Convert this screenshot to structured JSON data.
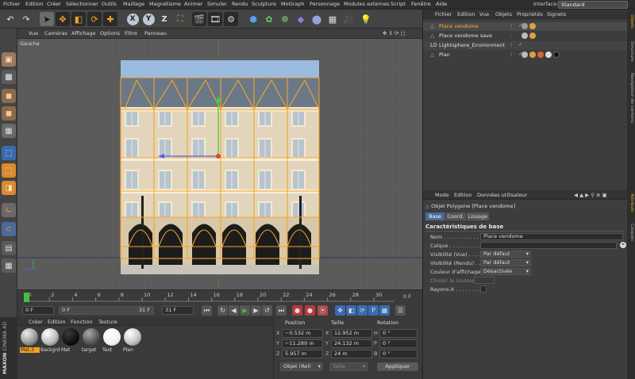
{
  "menubar": {
    "items": [
      "Fichier",
      "Edition",
      "Créer",
      "Sélectionner",
      "Outils",
      "Maillage",
      "Magnétisme",
      "Animer",
      "Simuler",
      "Rendu",
      "Sculpture",
      "MoGraph",
      "Personnage",
      "Modules externes",
      "Script",
      "Fenêtre",
      "Aide"
    ],
    "interface_label": "Interface:",
    "interface_value": "Standard"
  },
  "toolbar": {
    "axis_labels": {
      "x": "X",
      "y": "Y",
      "z": "Z"
    }
  },
  "viewport": {
    "menu": [
      "Vue",
      "Caméras",
      "Affichage",
      "Options",
      "Filtre",
      "Panneau"
    ],
    "view_name": "Gauche"
  },
  "timeline": {
    "ticks": [
      "0",
      "2",
      "4",
      "6",
      "8",
      "10",
      "12",
      "14",
      "16",
      "18",
      "20",
      "22",
      "24",
      "26",
      "28",
      "30"
    ],
    "end_label": "0 F",
    "current_frame": 0
  },
  "time_controls": {
    "start": "0 F",
    "range_start": "0 F",
    "range_end": "31 F",
    "end": "31 F"
  },
  "materials": {
    "menu": [
      "Créer",
      "Edition",
      "Fonction",
      "Texture"
    ],
    "items": [
      {
        "label": "Mat.3",
        "color": "#9a9a9a"
      },
      {
        "label": "Backgrd",
        "color": "#bdbdbd"
      },
      {
        "label": "Mat",
        "color": "#1a1a1a"
      },
      {
        "label": "target",
        "color": "#6a6a6a"
      },
      {
        "label": "Text",
        "color": "#f2f2f2"
      },
      {
        "label": "Plan",
        "color": "#c8c8c8"
      }
    ]
  },
  "brand": {
    "line1": "MAXON",
    "line2": "CINEMA 4D"
  },
  "coords": {
    "headers": {
      "position": "Position",
      "size": "Taille",
      "rotation": "Rotation"
    },
    "rows": [
      {
        "axis": "X",
        "pos": "−0.532 m",
        "size_axis": "X",
        "size": "12.952 m",
        "rot_axis": "H",
        "rot": "0 °"
      },
      {
        "axis": "Y",
        "pos": "−11.289 m",
        "size_axis": "Y",
        "size": "24.132 m",
        "rot_axis": "P",
        "rot": "0 °"
      },
      {
        "axis": "Z",
        "pos": "5.957 m",
        "size_axis": "Z",
        "size": "24 m",
        "rot_axis": "B",
        "rot": "0 °"
      }
    ],
    "mode": "Objet (Rel)",
    "size_mode": "Taille",
    "apply": "Appliquer"
  },
  "object_manager": {
    "menu": [
      "Fichier",
      "Edition",
      "Vue",
      "Objets",
      "Propriétés",
      "Signets"
    ],
    "objects": [
      {
        "name": "Place vendome",
        "color": "#ffb030",
        "selected": true,
        "icon": "polygon-icon"
      },
      {
        "name": "Place vendome save",
        "color": "#e0e0e0",
        "selected": false,
        "icon": "polygon-icon"
      },
      {
        "name": "Lightsphere_Environment",
        "color": "#e0e0e0",
        "selected": false,
        "icon": "null-icon"
      },
      {
        "name": "Plan",
        "color": "#e0e0e0",
        "selected": false,
        "icon": "polygon-icon"
      }
    ]
  },
  "attributes": {
    "menu": [
      "Mode",
      "Edition",
      "Données utilisateur"
    ],
    "object_title": "Objet Polygone [Place vendome]",
    "tabs": [
      "Base",
      "Coord.",
      "Lissage"
    ],
    "section": "Caractéristiques de base",
    "fields": [
      {
        "label": "Nom . . . . . . . . . . . . .",
        "value": "Place vendome",
        "type": "text"
      },
      {
        "label": "Calque . . . . . . . . . . .",
        "value": "",
        "type": "text"
      },
      {
        "label": "Visibilité (Vue) . . . . .",
        "value": "Par défaut",
        "type": "select"
      },
      {
        "label": "Visibilité (Rendu) . . .",
        "value": "Par défaut",
        "type": "select"
      },
      {
        "label": "Couleur d'affichage",
        "value": "Désactivée",
        "type": "select"
      },
      {
        "label": "Choisir la couleur",
        "value": "",
        "type": "color"
      },
      {
        "label": "Rayons-X . . . . . . . . . .",
        "value": "",
        "type": "check"
      }
    ]
  },
  "right_tabs": [
    "Objets",
    "Structure",
    "Navigateur de contenu",
    "Attributs",
    "Calques"
  ]
}
